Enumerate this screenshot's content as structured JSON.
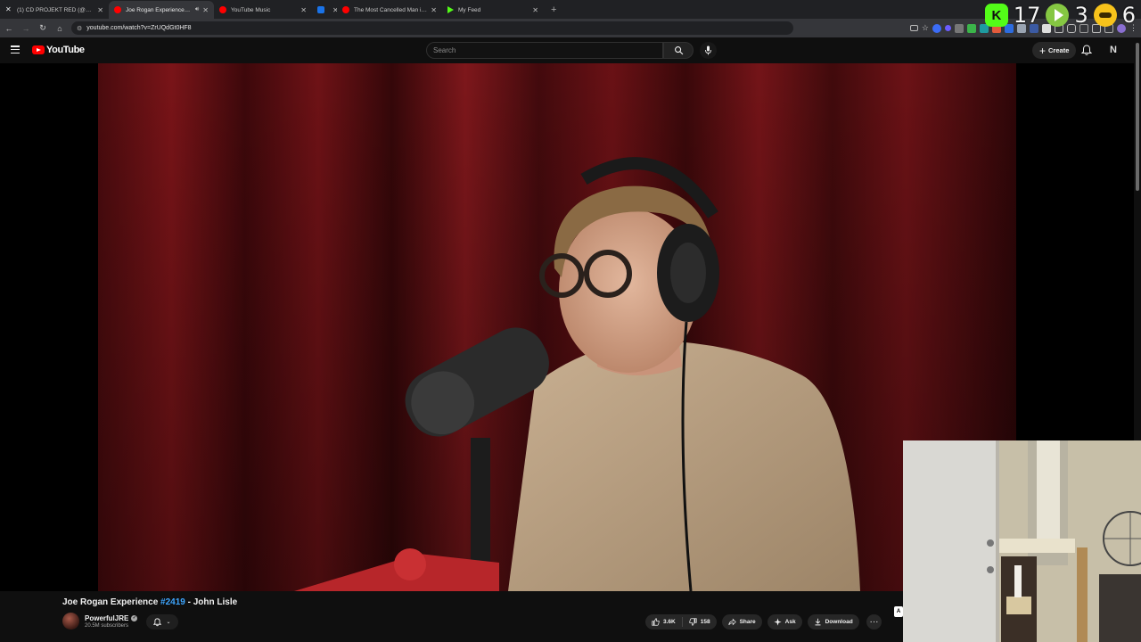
{
  "browser": {
    "tabs": [
      {
        "title": "(1) CD PROJEKT RED (@CDPROJEKTRED)",
        "favicon_color": "#e7e9ea",
        "active": false,
        "audio": false
      },
      {
        "title": "Joe Rogan Experience #2419 - John Lisle",
        "favicon_color": "#ff0000",
        "active": true,
        "audio": true
      },
      {
        "title": "YouTube Music",
        "favicon_color": "#ff0000",
        "active": false,
        "audio": false
      },
      {
        "title": "",
        "favicon_color": "#1a73e8",
        "active": false,
        "audio": false
      },
      {
        "title": "The Most Cancelled Man in America",
        "favicon_color": "#ff0000",
        "active": false,
        "audio": false
      },
      {
        "title": "My Feed",
        "favicon_color": "#53fc18",
        "active": false,
        "audio": false
      }
    ],
    "new_tab_glyph": "+",
    "url": "youtube.com/watch?v=ZrUQdGt0HF8"
  },
  "overlay": {
    "items": [
      {
        "icon": "kick-icon",
        "color": "#53fc18",
        "letter": "K",
        "count": "17"
      },
      {
        "icon": "rumble-icon",
        "color": "#85c742",
        "letter": "",
        "count": "3"
      },
      {
        "icon": "mask-icon",
        "color": "#f7c31b",
        "letter": "",
        "count": "6"
      }
    ]
  },
  "youtube": {
    "logo_text": "YouTube",
    "search_placeholder": "Search",
    "create_label": "Create",
    "avatar_letter": "N",
    "video_title_prefix": "Joe Rogan Experience ",
    "video_title_tag": "#2419",
    "video_title_suffix": " - John Lisle",
    "channel_name": "PowerfulJRE",
    "subscribers": "20.5M subscribers",
    "likes": "3.6K",
    "dislikes": "158",
    "share_label": "Share",
    "ask_label": "Ask",
    "download_label": "Download",
    "more_glyph": "···",
    "mini_badge": "A"
  },
  "colors": {
    "accent": "#ff0000",
    "link": "#3ea6ff",
    "background": "#0f0f0f"
  }
}
